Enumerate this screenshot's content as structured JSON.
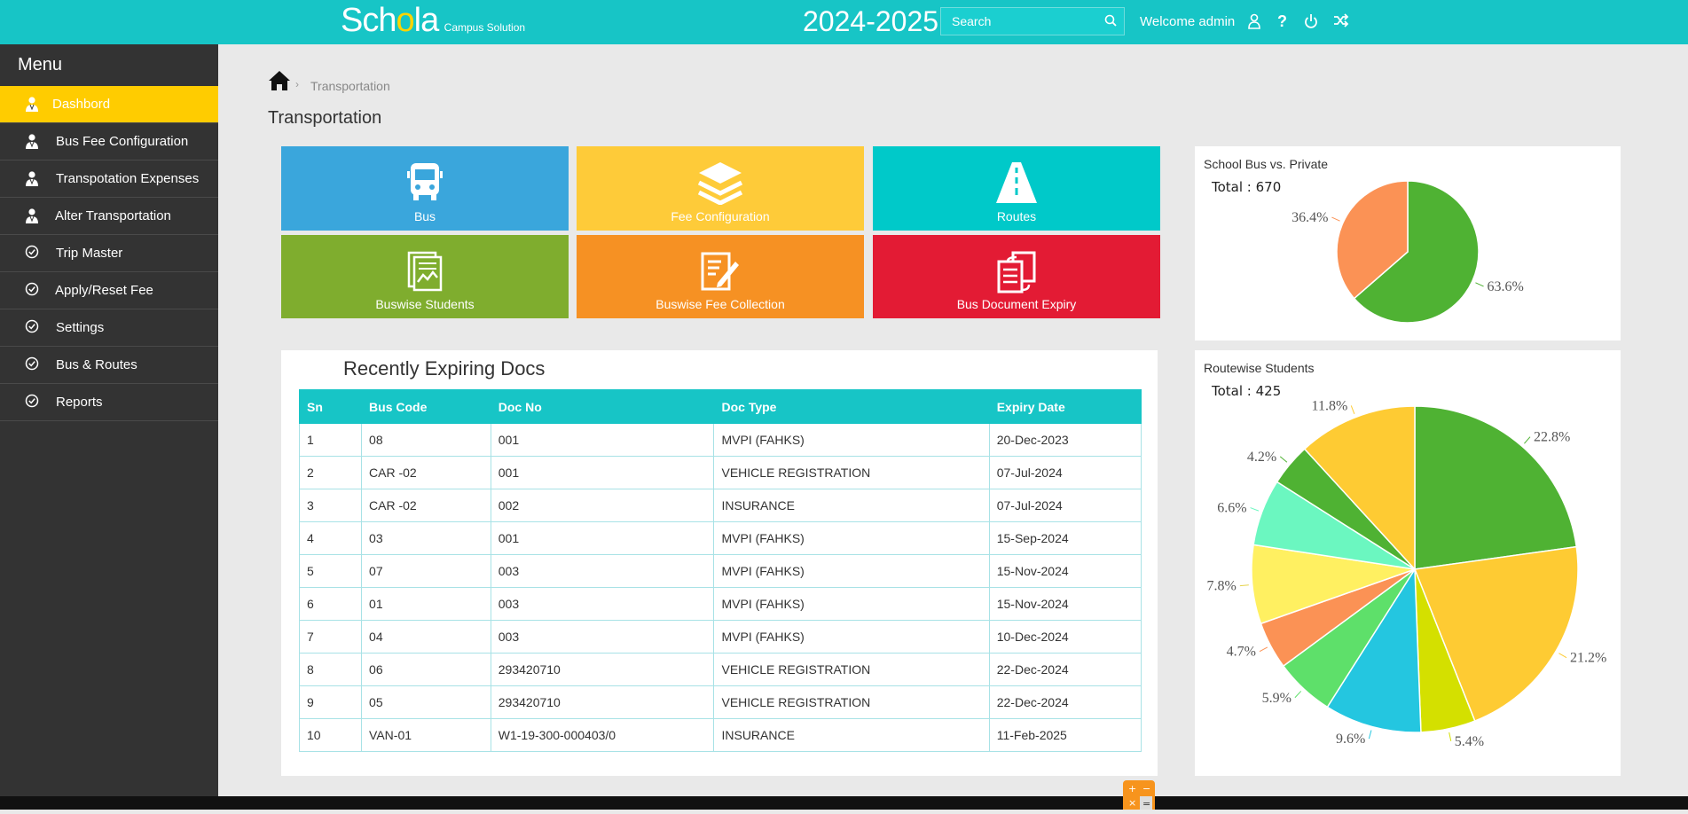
{
  "header": {
    "brand_prefix": "Sch",
    "brand_o": "o",
    "brand_suffix": "la",
    "brand_sub": "Campus Solution",
    "year": "2024-2025",
    "search_placeholder": "Search",
    "welcome": "Welcome admin",
    "icons": [
      "user-icon",
      "help-icon",
      "power-icon",
      "shuffle-icon"
    ]
  },
  "sidebar": {
    "title": "Menu",
    "items": [
      {
        "label": "Dashbord",
        "icon": "user-icon",
        "active": true
      },
      {
        "label": "Bus Fee Configuration",
        "icon": "user-icon"
      },
      {
        "label": "Transpotation Expenses",
        "icon": "user-icon"
      },
      {
        "label": "Alter Transportation",
        "icon": "user-icon"
      },
      {
        "label": "Trip Master",
        "icon": "check-circle-icon"
      },
      {
        "label": "Apply/Reset Fee",
        "icon": "check-circle-icon"
      },
      {
        "label": "Settings",
        "icon": "check-circle-icon"
      },
      {
        "label": "Bus & Routes",
        "icon": "check-circle-icon"
      },
      {
        "label": "Reports",
        "icon": "check-circle-icon"
      }
    ]
  },
  "breadcrumb": {
    "current": "Transportation"
  },
  "page_title": "Transportation",
  "tiles": [
    {
      "label": "Bus",
      "icon": "bus-icon",
      "color": "#3aa6dc"
    },
    {
      "label": "Fee Configuration",
      "icon": "layers-icon",
      "color": "#fecb39"
    },
    {
      "label": "Routes",
      "icon": "road-icon",
      "color": "#00c9c9"
    },
    {
      "label": "Buswise Students",
      "icon": "report-icon",
      "color": "#7fad2e"
    },
    {
      "label": "Buswise Fee Collection",
      "icon": "edit-document-icon",
      "color": "#f69123"
    },
    {
      "label": "Bus Document Expiry",
      "icon": "documents-icon",
      "color": "#e31b34"
    }
  ],
  "docs": {
    "title": "Recently Expiring Docs",
    "columns": [
      "Sn",
      "Bus Code",
      "Doc No",
      "Doc Type",
      "Expiry Date"
    ],
    "rows": [
      [
        "1",
        "08",
        "001",
        "MVPI (FAHKS)",
        "20-Dec-2023"
      ],
      [
        "2",
        "CAR -02",
        "001",
        "VEHICLE REGISTRATION",
        "07-Jul-2024"
      ],
      [
        "3",
        "CAR -02",
        "002",
        "INSURANCE",
        "07-Jul-2024"
      ],
      [
        "4",
        "03",
        "001",
        "MVPI (FAHKS)",
        "15-Sep-2024"
      ],
      [
        "5",
        "07",
        "003",
        "MVPI (FAHKS)",
        "15-Nov-2024"
      ],
      [
        "6",
        "01",
        "003",
        "MVPI (FAHKS)",
        "15-Nov-2024"
      ],
      [
        "7",
        "04",
        "003",
        "MVPI (FAHKS)",
        "10-Dec-2024"
      ],
      [
        "8",
        "06",
        "293420710",
        "VEHICLE REGISTRATION",
        "22-Dec-2024"
      ],
      [
        "9",
        "05",
        "293420710",
        "VEHICLE REGISTRATION",
        "22-Dec-2024"
      ],
      [
        "10",
        "VAN-01",
        "W1-19-300-000403/0",
        "INSURANCE",
        "11-Feb-2025"
      ]
    ]
  },
  "chart_data": [
    {
      "type": "pie",
      "title": "School Bus vs. Private",
      "total_label": "Total : 670",
      "slices": [
        {
          "label": "63.6%",
          "value": 63.6,
          "color": "#4fb233"
        },
        {
          "label": "36.4%",
          "value": 36.4,
          "color": "#fb9255"
        }
      ]
    },
    {
      "type": "pie",
      "title": "Routewise Students",
      "total_label": "Total : 425",
      "slices": [
        {
          "label": "22.8%",
          "value": 22.8,
          "color": "#4fb233"
        },
        {
          "label": "21.2%",
          "value": 21.2,
          "color": "#fecb33"
        },
        {
          "label": "5.4%",
          "value": 5.4,
          "color": "#d4e000"
        },
        {
          "label": "9.6%",
          "value": 9.6,
          "color": "#24c6e0"
        },
        {
          "label": "5.9%",
          "value": 5.9,
          "color": "#5ee06a"
        },
        {
          "label": "4.7%",
          "value": 4.7,
          "color": "#fb9255"
        },
        {
          "label": "7.8%",
          "value": 7.8,
          "color": "#fff061"
        },
        {
          "label": "6.6%",
          "value": 6.6,
          "color": "#6bf7c0"
        },
        {
          "label": "4.2%",
          "value": 4.2,
          "color": "#4fb233"
        },
        {
          "label": "11.8%",
          "value": 11.8,
          "color": "#fecb33"
        }
      ]
    }
  ]
}
